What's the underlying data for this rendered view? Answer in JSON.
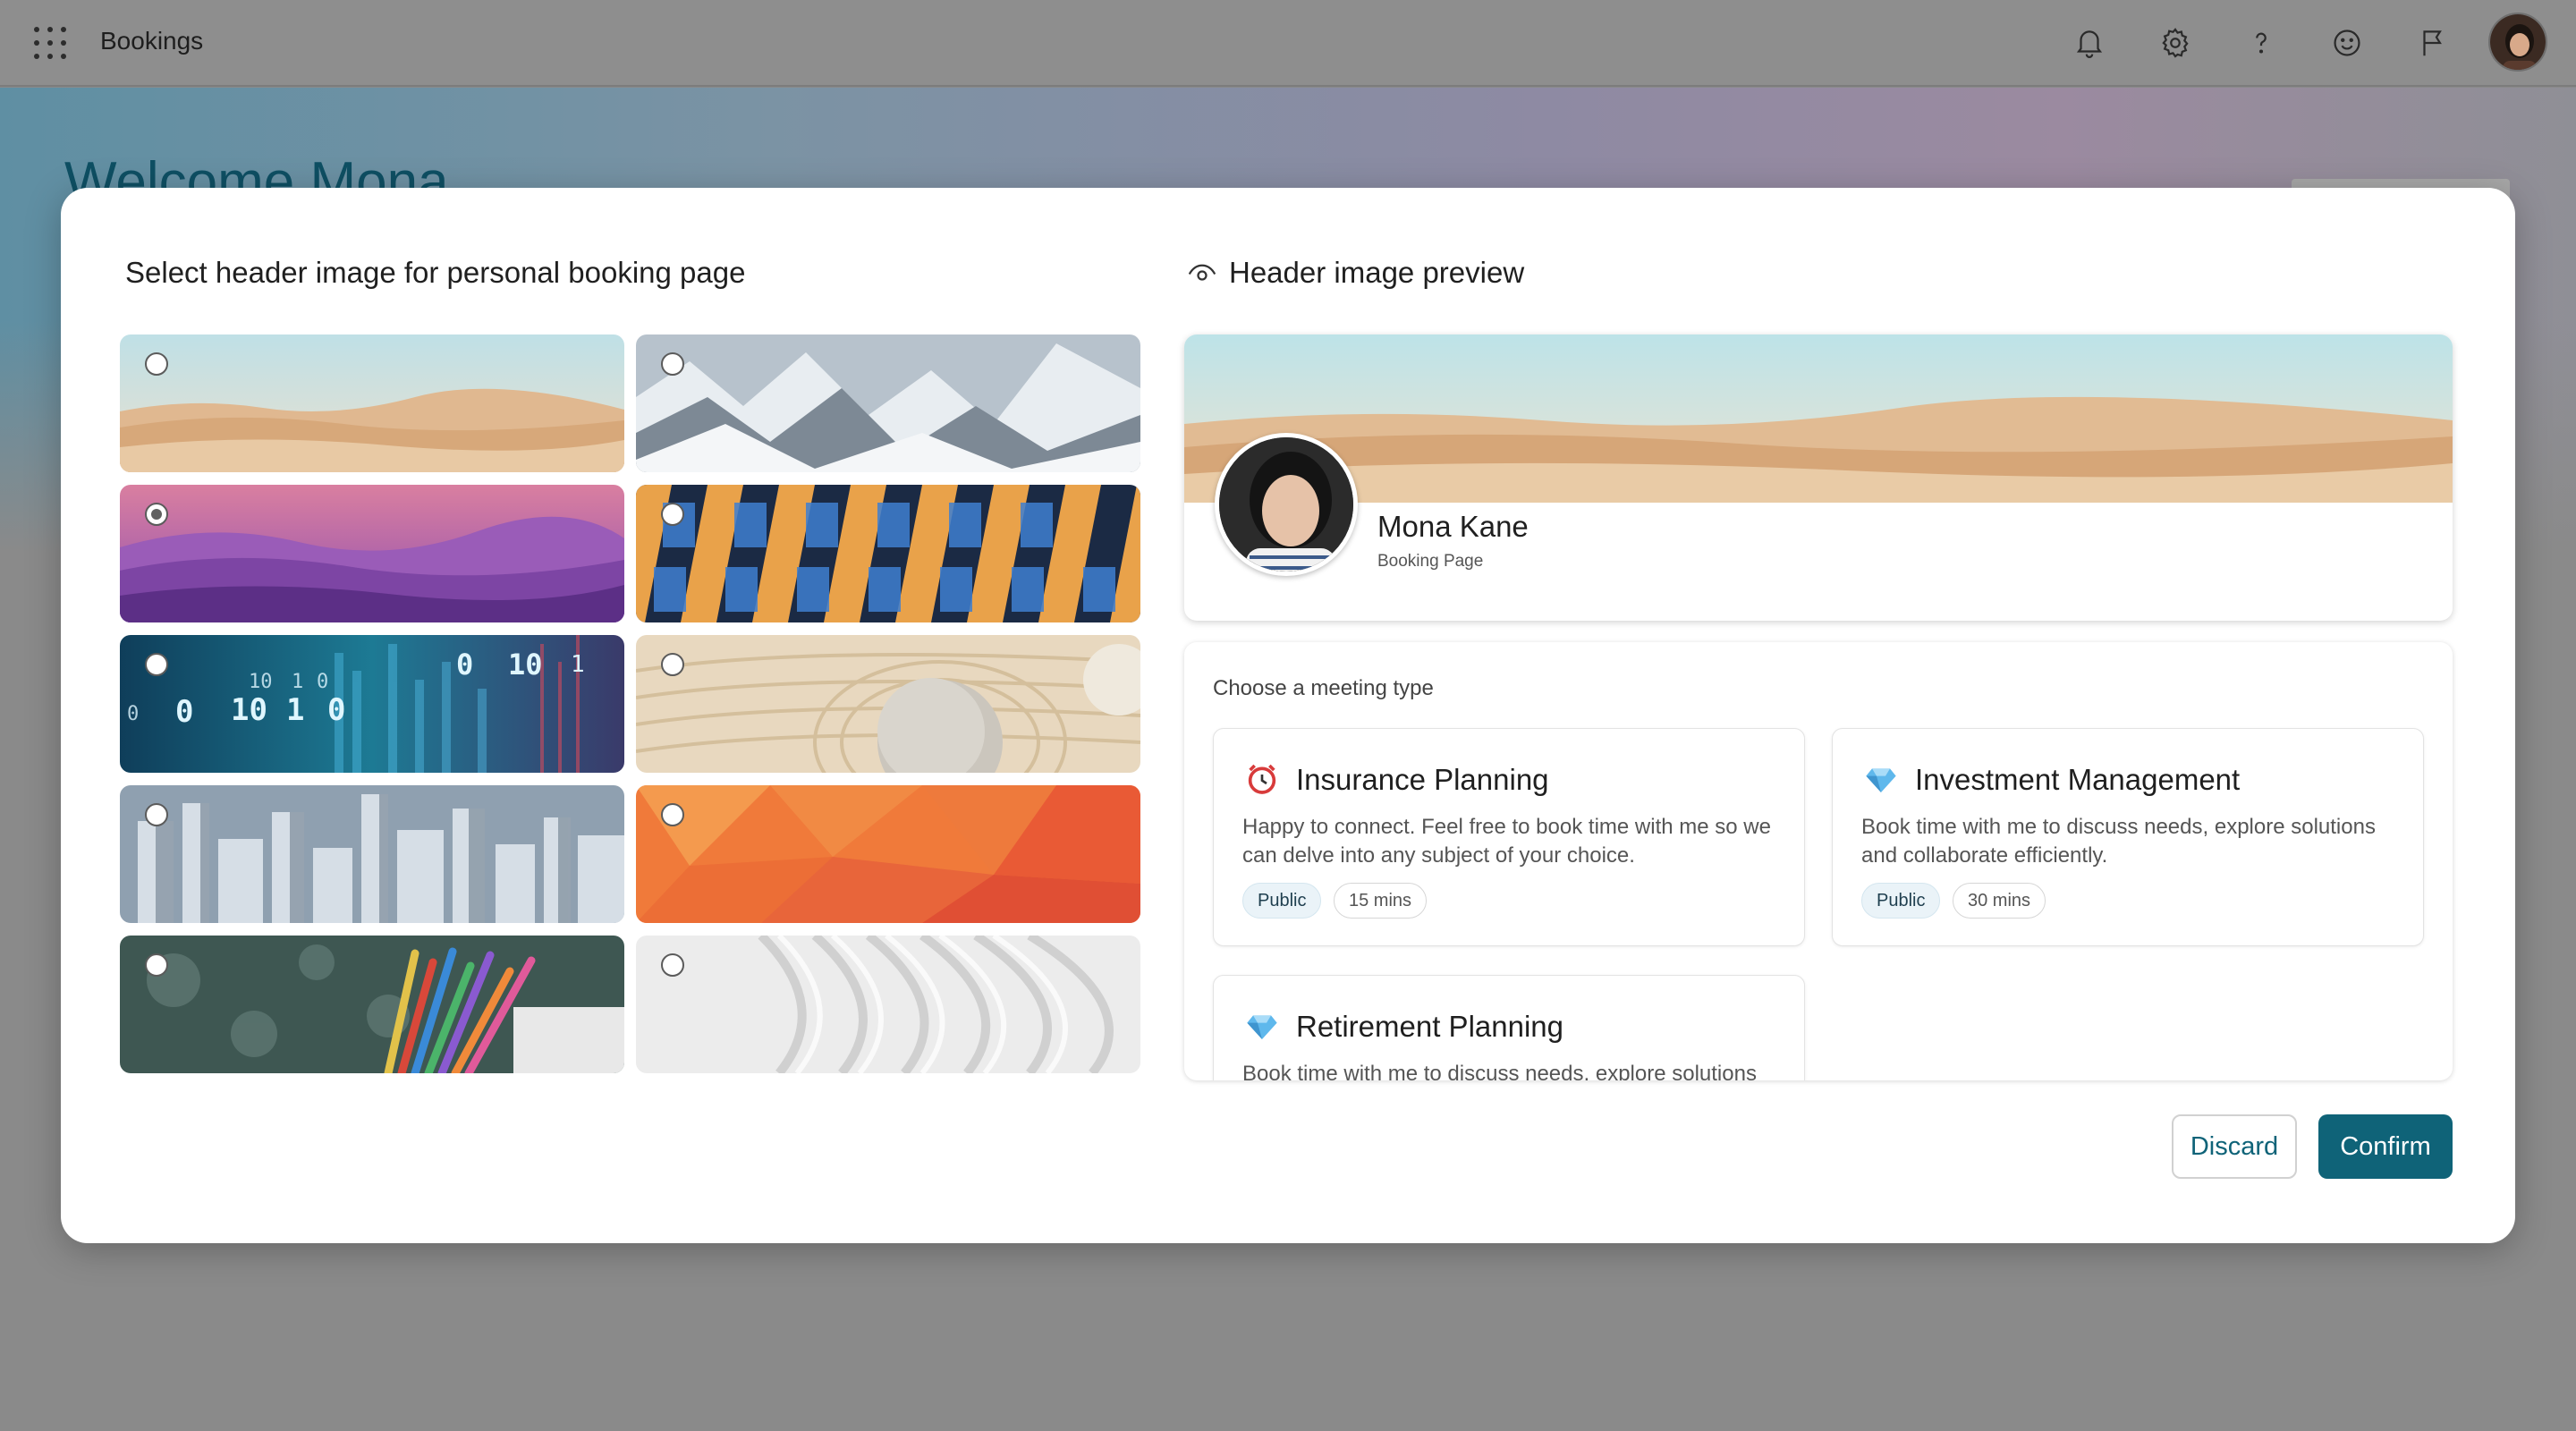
{
  "app": {
    "title": "Bookings"
  },
  "topbar": {
    "icons": [
      "waffle-icon",
      "bell-icon",
      "gear-icon",
      "help-icon",
      "smiley-icon",
      "flag-icon"
    ]
  },
  "page": {
    "welcome": "Welcome Mona"
  },
  "modal": {
    "select_title": "Select header image for personal booking page",
    "preview_title": "Header image preview",
    "images": [
      {
        "name": "desert",
        "selected": false
      },
      {
        "name": "snowy-mountains",
        "selected": false
      },
      {
        "name": "purple-mountains",
        "selected": true
      },
      {
        "name": "building-facade",
        "selected": false
      },
      {
        "name": "binary-data",
        "selected": false,
        "digits": [
          "0",
          "10",
          "1",
          "0",
          "0",
          "10",
          "1",
          "0",
          "0",
          "10",
          "1"
        ]
      },
      {
        "name": "zen-sand-stone",
        "selected": false
      },
      {
        "name": "city-skyline",
        "selected": false
      },
      {
        "name": "orange-polygons",
        "selected": false
      },
      {
        "name": "colored-pencils",
        "selected": false
      },
      {
        "name": "white-waves",
        "selected": false
      }
    ],
    "preview": {
      "name": "Mona Kane",
      "subtitle": "Booking Page"
    },
    "meeting": {
      "label": "Choose a meeting type",
      "types": [
        {
          "title": "Insurance Planning",
          "icon": "alarm-clock-icon",
          "description": "Happy to connect. Feel free to book time with me so we can delve into any subject of your choice.",
          "visibility": "Public",
          "duration": "15 mins"
        },
        {
          "title": "Investment Management",
          "icon": "diamond-icon",
          "description": "Book time with me to discuss needs, explore solutions and collaborate efficiently.",
          "visibility": "Public",
          "duration": "30 mins"
        },
        {
          "title": "Retirement Planning",
          "icon": "diamond-icon",
          "description": "Book time with me to discuss needs, explore solutions"
        }
      ]
    },
    "buttons": {
      "discard": "Discard",
      "confirm": "Confirm"
    }
  },
  "colors": {
    "accent": "#0f6378",
    "welcome": "#0e4f63"
  }
}
